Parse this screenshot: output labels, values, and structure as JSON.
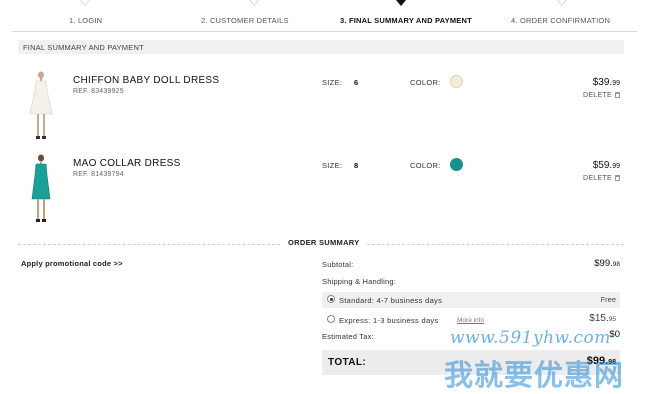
{
  "steps": [
    {
      "label": "1. LOGIN",
      "active": false
    },
    {
      "label": "2. CUSTOMER DETAILS",
      "active": false
    },
    {
      "label": "3. FINAL SUMMARY AND PAYMENT",
      "active": true
    },
    {
      "label": "4. ORDER CONFIRMATION",
      "active": false
    }
  ],
  "section_title": "FINAL SUMMARY AND PAYMENT",
  "labels": {
    "size": "SIZE:",
    "color": "COLOR:",
    "delete": "DELETE"
  },
  "items": [
    {
      "name": "CHIFFON BABY DOLL DRESS",
      "ref": "REF. 83439925",
      "size": "6",
      "color_hex": "#f3ecd8",
      "price_main": "$39.",
      "price_cents": "99"
    },
    {
      "name": "MAO COLLAR DRESS",
      "ref": "REF. 81439794",
      "size": "8",
      "color_hex": "#17908a",
      "price_main": "$59.",
      "price_cents": "99"
    }
  ],
  "summary": {
    "title": "ORDER SUMMARY",
    "promo_link": "Apply promotional code >>",
    "subtotal_label": "Subtotal:",
    "subtotal_main": "$99.",
    "subtotal_cents": "98",
    "shipping_label": "Shipping & Handling:",
    "shipping_options": [
      {
        "label": "Standard: 4-7 business days",
        "price": "Free",
        "selected": true
      },
      {
        "label": "Express: 1-3 business days",
        "more_info": "More info",
        "price_main": "$15.",
        "price_cents": "95",
        "selected": false
      }
    ],
    "tax_label": "Estimated Tax:",
    "tax_value": "$0",
    "total_label": "TOTAL:",
    "total_main": "$99.",
    "total_cents": "98"
  },
  "watermark": {
    "url": "www.591yhw.com",
    "text": "我就要优惠网"
  }
}
